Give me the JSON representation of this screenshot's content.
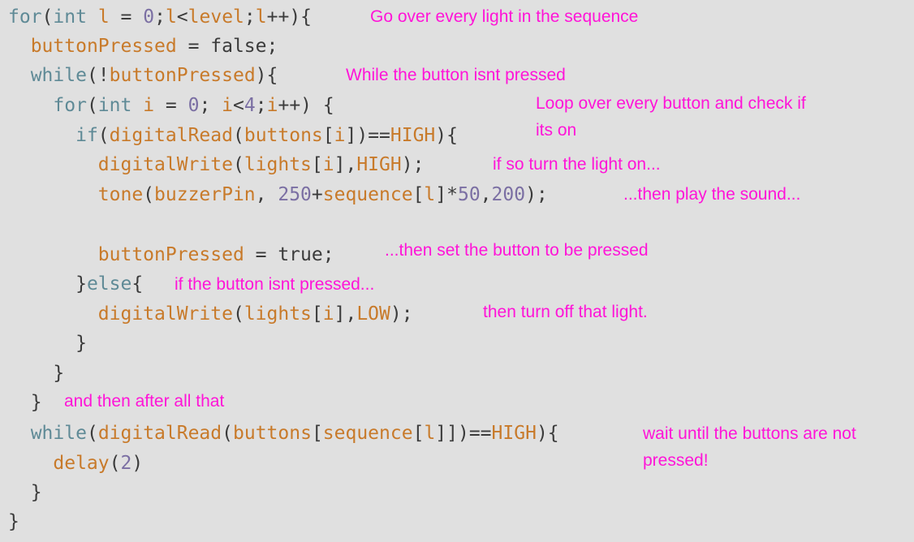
{
  "code": [
    [
      [
        "kw",
        "for"
      ],
      [
        "pl",
        "("
      ],
      [
        "kw",
        "int"
      ],
      [
        "pl",
        " "
      ],
      [
        "fn",
        "l"
      ],
      [
        "pl",
        " = "
      ],
      [
        "num",
        "0"
      ],
      [
        "pl",
        ";"
      ],
      [
        "fn",
        "l"
      ],
      [
        "pl",
        "<"
      ],
      [
        "fn",
        "level"
      ],
      [
        "pl",
        ";"
      ],
      [
        "fn",
        "l"
      ],
      [
        "pl",
        "++){"
      ]
    ],
    [
      [
        "pl",
        "  "
      ],
      [
        "fn",
        "buttonPressed"
      ],
      [
        "pl",
        " = false;"
      ]
    ],
    [
      [
        "pl",
        "  "
      ],
      [
        "kw",
        "while"
      ],
      [
        "pl",
        "(!"
      ],
      [
        "fn",
        "buttonPressed"
      ],
      [
        "pl",
        "){"
      ]
    ],
    [
      [
        "pl",
        "    "
      ],
      [
        "kw",
        "for"
      ],
      [
        "pl",
        "("
      ],
      [
        "kw",
        "int"
      ],
      [
        "pl",
        " "
      ],
      [
        "fn",
        "i"
      ],
      [
        "pl",
        " = "
      ],
      [
        "num",
        "0"
      ],
      [
        "pl",
        "; "
      ],
      [
        "fn",
        "i"
      ],
      [
        "pl",
        "<"
      ],
      [
        "num",
        "4"
      ],
      [
        "pl",
        ";"
      ],
      [
        "fn",
        "i"
      ],
      [
        "pl",
        "++) {"
      ]
    ],
    [
      [
        "pl",
        "      "
      ],
      [
        "kw",
        "if"
      ],
      [
        "pl",
        "("
      ],
      [
        "fn",
        "digitalRead"
      ],
      [
        "pl",
        "("
      ],
      [
        "fn",
        "buttons"
      ],
      [
        "pl",
        "["
      ],
      [
        "fn",
        "i"
      ],
      [
        "pl",
        "])=="
      ],
      [
        "fn",
        "HIGH"
      ],
      [
        "pl",
        "){"
      ]
    ],
    [
      [
        "pl",
        "        "
      ],
      [
        "fn",
        "digitalWrite"
      ],
      [
        "pl",
        "("
      ],
      [
        "fn",
        "lights"
      ],
      [
        "pl",
        "["
      ],
      [
        "fn",
        "i"
      ],
      [
        "pl",
        "],"
      ],
      [
        "fn",
        "HIGH"
      ],
      [
        "pl",
        ");"
      ]
    ],
    [
      [
        "pl",
        "        "
      ],
      [
        "fn",
        "tone"
      ],
      [
        "pl",
        "("
      ],
      [
        "fn",
        "buzzerPin"
      ],
      [
        "pl",
        ", "
      ],
      [
        "num",
        "250"
      ],
      [
        "pl",
        "+"
      ],
      [
        "fn",
        "sequence"
      ],
      [
        "pl",
        "["
      ],
      [
        "fn",
        "l"
      ],
      [
        "pl",
        "]*"
      ],
      [
        "num",
        "50"
      ],
      [
        "pl",
        ","
      ],
      [
        "num",
        "200"
      ],
      [
        "pl",
        ");"
      ]
    ],
    [
      [
        "pl",
        "        "
      ],
      [
        "fn",
        "buttonPressed"
      ],
      [
        "pl",
        " = true;"
      ]
    ],
    [
      [
        "pl",
        "      }"
      ],
      [
        "kw",
        "else"
      ],
      [
        "pl",
        "{"
      ]
    ],
    [
      [
        "pl",
        "        "
      ],
      [
        "fn",
        "digitalWrite"
      ],
      [
        "pl",
        "("
      ],
      [
        "fn",
        "lights"
      ],
      [
        "pl",
        "["
      ],
      [
        "fn",
        "i"
      ],
      [
        "pl",
        "],"
      ],
      [
        "fn",
        "LOW"
      ],
      [
        "pl",
        ");"
      ]
    ],
    [
      [
        "pl",
        "      }"
      ]
    ],
    [
      [
        "pl",
        "    }"
      ]
    ],
    [
      [
        "pl",
        "  }"
      ]
    ],
    [
      [
        "pl",
        "  "
      ],
      [
        "kw",
        "while"
      ],
      [
        "pl",
        "("
      ],
      [
        "fn",
        "digitalRead"
      ],
      [
        "pl",
        "("
      ],
      [
        "fn",
        "buttons"
      ],
      [
        "pl",
        "["
      ],
      [
        "fn",
        "sequence"
      ],
      [
        "pl",
        "["
      ],
      [
        "fn",
        "l"
      ],
      [
        "pl",
        "]])=="
      ],
      [
        "fn",
        "HIGH"
      ],
      [
        "pl",
        "){"
      ]
    ],
    [
      [
        "pl",
        "    "
      ],
      [
        "fn",
        "delay"
      ],
      [
        "pl",
        "("
      ],
      [
        "num",
        "2"
      ],
      [
        "pl",
        ")"
      ]
    ],
    [
      [
        "pl",
        "  }"
      ]
    ],
    [
      [
        "pl",
        "}"
      ]
    ]
  ],
  "notes": [
    "Go over every light in the sequence",
    "While the button isnt pressed",
    "Loop over every button and check if",
    "its on",
    "if so turn the light on...",
    "...then play the sound...",
    "...then set the button to be pressed",
    "if the button isnt pressed...",
    "then turn off that light.",
    "and then after all that",
    "wait until the buttons are not",
    "pressed!"
  ]
}
